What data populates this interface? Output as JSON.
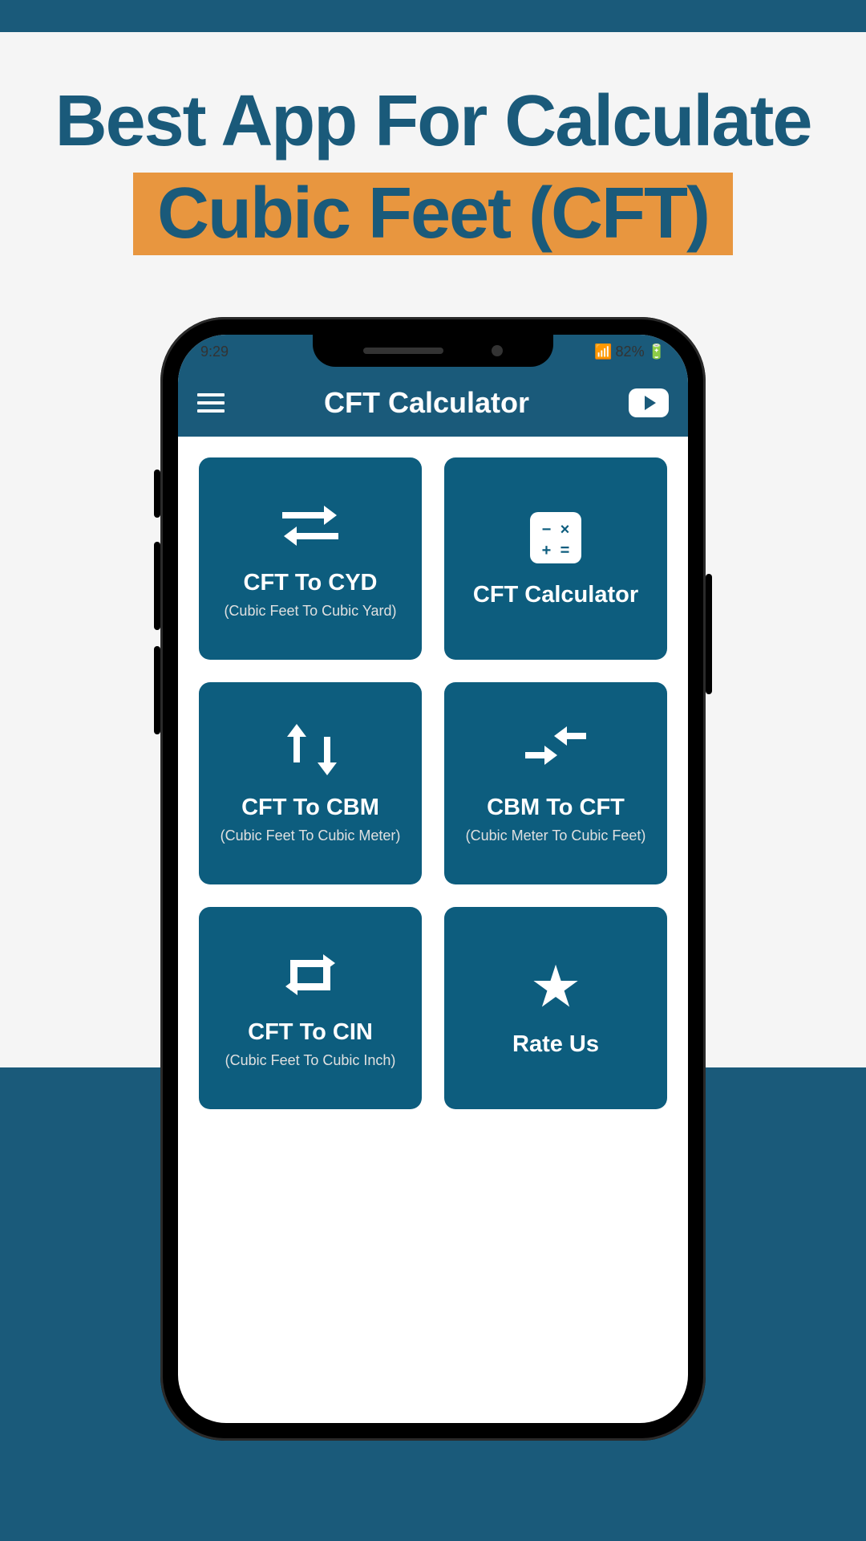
{
  "headline": {
    "line1": "Best App For Calculate",
    "line2": "Cubic Feet (CFT)"
  },
  "statusBar": {
    "time": "9:29",
    "battery": "82%"
  },
  "header": {
    "title": "CFT Calculator"
  },
  "tiles": [
    {
      "icon": "swap-horizontal-icon",
      "title": "CFT To CYD",
      "subtitle": "(Cubic Feet To Cubic Yard)"
    },
    {
      "icon": "calculator-icon",
      "title": "CFT Calculator",
      "subtitle": ""
    },
    {
      "icon": "swap-vertical-icon",
      "title": "CFT To CBM",
      "subtitle": "(Cubic Feet To Cubic Meter)"
    },
    {
      "icon": "converge-arrows-icon",
      "title": "CBM To CFT",
      "subtitle": "(Cubic Meter To Cubic Feet)"
    },
    {
      "icon": "cycle-icon",
      "title": "CFT To CIN",
      "subtitle": "(Cubic Feet To Cubic Inch)"
    },
    {
      "icon": "star-icon",
      "title": "Rate Us",
      "subtitle": ""
    }
  ],
  "colors": {
    "primary": "#1a5a7a",
    "accent": "#e8963f",
    "tile": "#0d5d7e"
  }
}
